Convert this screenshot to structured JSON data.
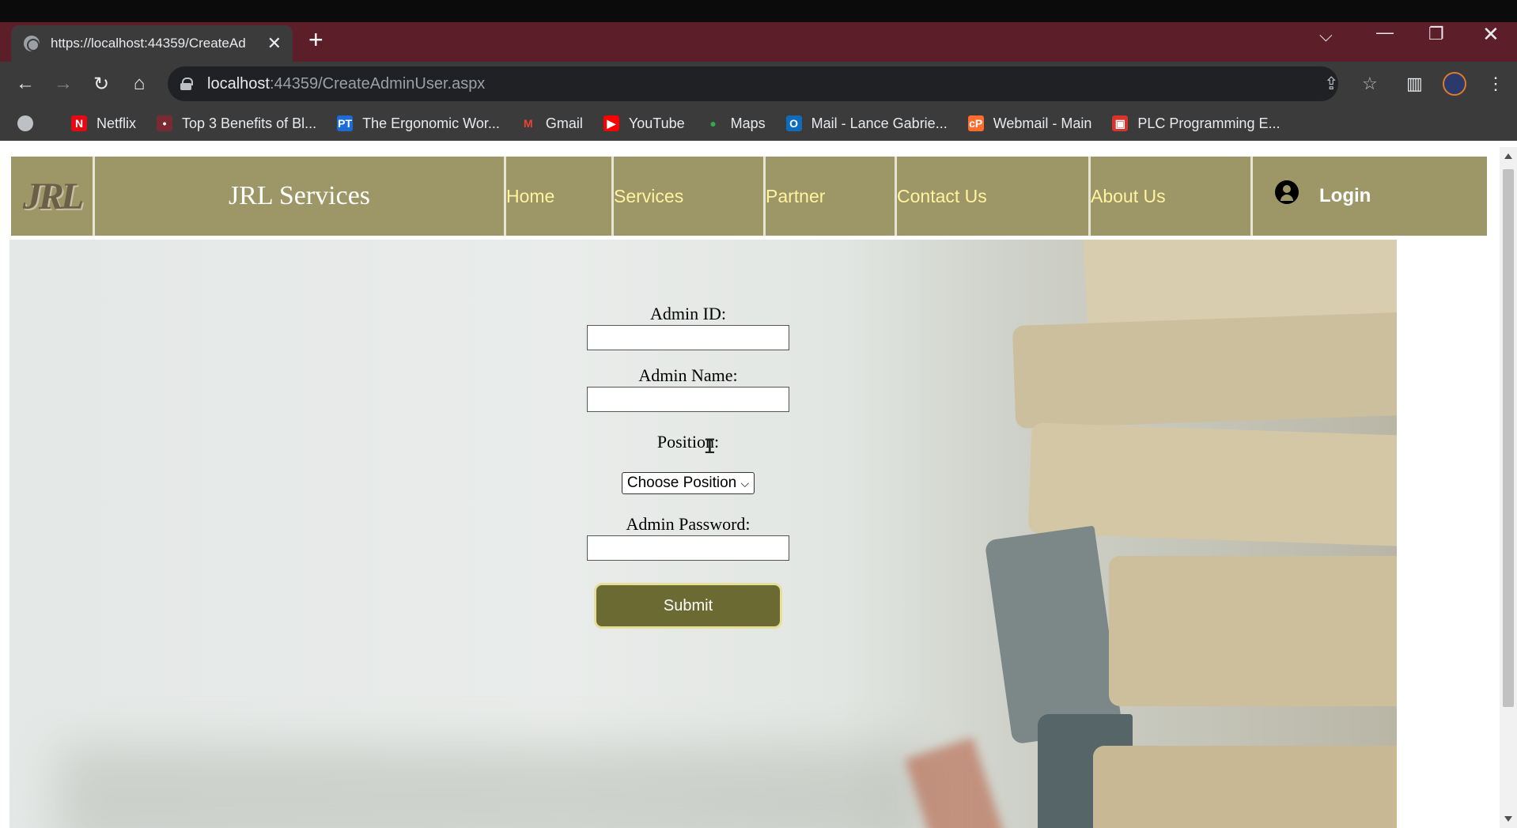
{
  "browser": {
    "tab_title": "https://localhost:44359/CreateAd",
    "url_host": "localhost",
    "url_path": ":44359/CreateAdminUser.aspx",
    "bookmarks": [
      {
        "label": "",
        "icon": "globe-icon",
        "color": "#bdc1c6"
      },
      {
        "label": "Netflix",
        "icon": "netflix-icon",
        "color": "#e50914"
      },
      {
        "label": "Top 3 Benefits of Bl...",
        "icon": "site-icon",
        "color": "#7a2a30"
      },
      {
        "label": "The Ergonomic Wor...",
        "icon": "pt-icon",
        "color": "#1d6bd6"
      },
      {
        "label": "Gmail",
        "icon": "gmail-icon",
        "color": "#ea4335"
      },
      {
        "label": "YouTube",
        "icon": "youtube-icon",
        "color": "#ff0000"
      },
      {
        "label": "Maps",
        "icon": "maps-icon",
        "color": "#34a853"
      },
      {
        "label": "Mail - Lance Gabrie...",
        "icon": "outlook-icon",
        "color": "#0f6cbd"
      },
      {
        "label": "Webmail - Main",
        "icon": "cpanel-icon",
        "color": "#ff6c2c"
      },
      {
        "label": "PLC Programming E...",
        "icon": "plc-icon",
        "color": "#d9342b"
      }
    ]
  },
  "site": {
    "logo_text": "JRL",
    "brand": "JRL Services",
    "nav": [
      "Home",
      "Services",
      "Partner",
      "Contact Us",
      "About Us"
    ],
    "login_label": "Login",
    "colors": {
      "navbar": "#9d9666",
      "nav_link": "#fff3a0",
      "submit": "#6b6a32"
    }
  },
  "form": {
    "admin_id_label": "Admin ID:",
    "admin_id_value": "",
    "admin_name_label": "Admin Name:",
    "admin_name_value": "",
    "position_label": "Position:",
    "position_selected": "Choose Position",
    "password_label": "Admin Password:",
    "password_value": "",
    "submit_label": "Submit"
  }
}
